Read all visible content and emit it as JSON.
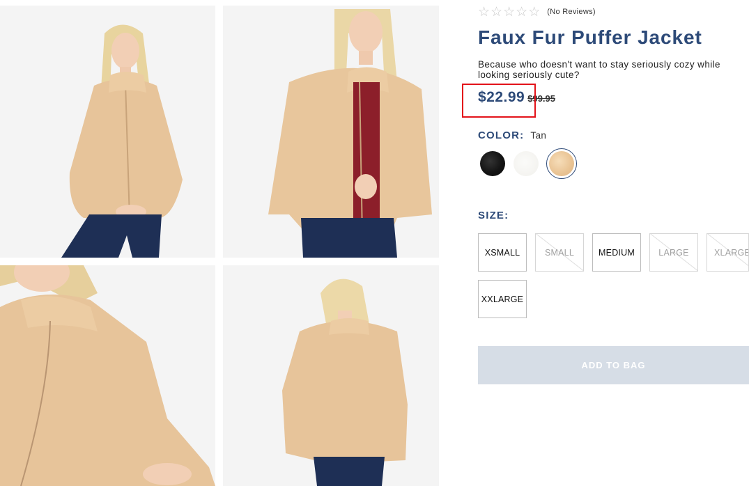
{
  "gallery": {
    "images": [
      {
        "name": "model-front-view"
      },
      {
        "name": "model-front-angled-view"
      },
      {
        "name": "zipper-closeup-view"
      },
      {
        "name": "model-back-view"
      }
    ]
  },
  "product": {
    "rating": {
      "stars": 0,
      "max_stars": 5,
      "reviews_text": "(No Reviews)"
    },
    "title": "Faux Fur Puffer Jacket",
    "description": "Because who doesn't want to stay seriously cozy while looking seriously cute?",
    "price": {
      "sale": "$22.99",
      "original": "$99.95"
    },
    "color": {
      "label": "COLOR:",
      "selected": "Tan",
      "swatches": [
        {
          "name": "Black",
          "hex": "#141414"
        },
        {
          "name": "White",
          "hex": "#f3f2ee"
        },
        {
          "name": "Tan",
          "hex": "#eac596",
          "selected": true
        }
      ]
    },
    "size": {
      "label": "SIZE:",
      "options": [
        {
          "label": "XSMALL",
          "available": true
        },
        {
          "label": "SMALL",
          "available": false
        },
        {
          "label": "MEDIUM",
          "available": true
        },
        {
          "label": "LARGE",
          "available": false
        },
        {
          "label": "XLARGE",
          "available": false
        },
        {
          "label": "XXLARGE",
          "available": true
        }
      ]
    },
    "add_to_bag_label": "ADD TO BAG"
  },
  "colors": {
    "brand_navy": "#2d4a78",
    "highlight_red": "#e3131a",
    "button_disabled": "#d6dde6",
    "jacket_tan": "#eac596",
    "jeans_navy": "#1e2f55"
  }
}
